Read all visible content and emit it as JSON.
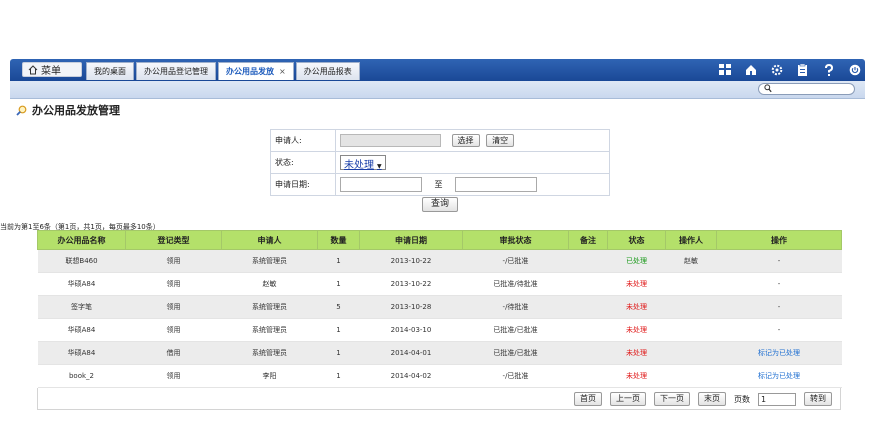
{
  "topbar": {
    "menu_label": "菜单",
    "tabs": [
      {
        "label": "我的桌面",
        "active": false
      },
      {
        "label": "办公用品登记管理",
        "active": false
      },
      {
        "label": "办公用品发放",
        "active": true,
        "close": "×"
      },
      {
        "label": "办公用品报表",
        "active": false
      }
    ],
    "right_icons": [
      "grid-icon",
      "home-icon",
      "gear-icon",
      "clipboard-icon",
      "help-icon",
      "power-icon"
    ],
    "search_icon": "search-icon"
  },
  "page_title": "办公用品发放管理",
  "form": {
    "applicant_label": "申请人:",
    "select_btn": "选择",
    "clear_btn": "清空",
    "status_label": "状态:",
    "status_value": "未处理",
    "date_label": "申请日期:",
    "date_sep": "至",
    "query_btn": "查询"
  },
  "record_info": "当前为第1至6条（第1页，共1页，每页最多10条）",
  "table": {
    "headers": [
      "办公用品名称",
      "登记类型",
      "申请人",
      "数量",
      "申请日期",
      "审批状态",
      "备注",
      "状态",
      "操作人",
      "操作"
    ],
    "rows": [
      [
        "联想B460",
        "领用",
        "系统管理员",
        "1",
        "2013-10-22",
        "-/已批准",
        "",
        "已处理",
        "赵敏",
        "-"
      ],
      [
        "华硕A84",
        "领用",
        "赵敏",
        "1",
        "2013-10-22",
        "已批准/待批准",
        "",
        "未处理",
        "",
        "-"
      ],
      [
        "签字笔",
        "领用",
        "系统管理员",
        "5",
        "2013-10-28",
        "-/待批准",
        "",
        "未处理",
        "",
        "-"
      ],
      [
        "华硕A84",
        "领用",
        "系统管理员",
        "1",
        "2014-03-10",
        "已批准/已批准",
        "",
        "未处理",
        "",
        "-"
      ],
      [
        "华硕A84",
        "借用",
        "系统管理员",
        "1",
        "2014-04-01",
        "已批准/已批准",
        "",
        "未处理",
        "",
        "标记为已处理"
      ],
      [
        "book_2",
        "领用",
        "李阳",
        "1",
        "2014-04-02",
        "-/已批准",
        "",
        "未处理",
        "",
        "标记为已处理"
      ]
    ]
  },
  "pager": {
    "first": "首页",
    "prev": "上一页",
    "next": "下一页",
    "last": "末页",
    "page_label": "页数",
    "page_value": "1",
    "go": "转到"
  }
}
